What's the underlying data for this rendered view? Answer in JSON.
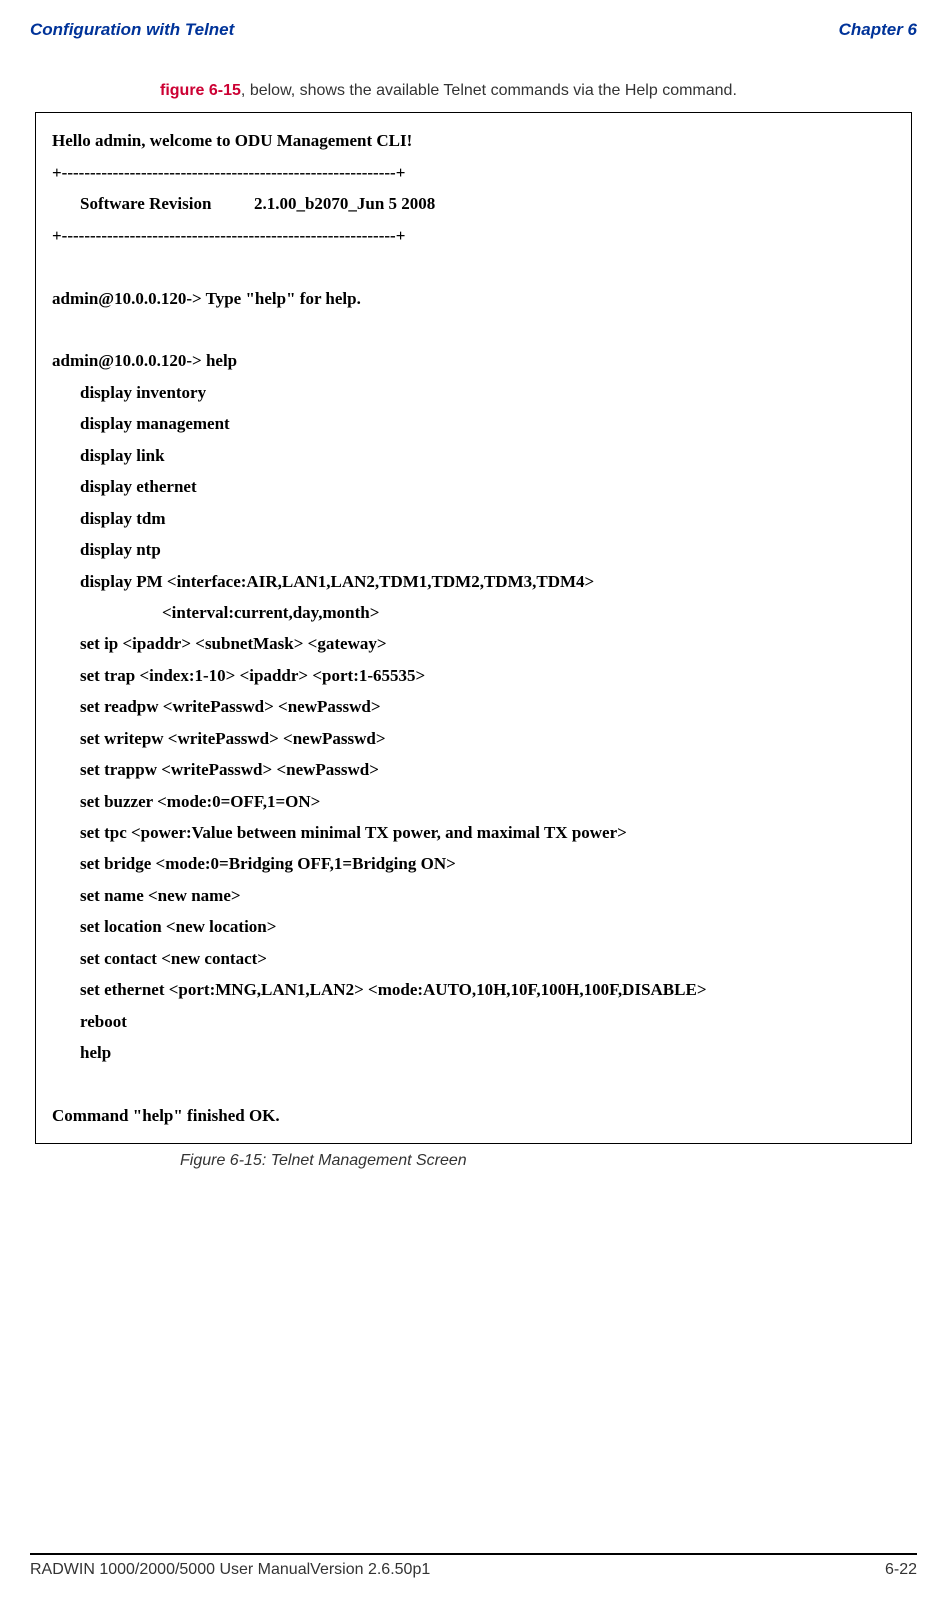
{
  "header": {
    "left": "Configuration with Telnet",
    "right": "Chapter 6"
  },
  "intro": {
    "figref": "figure 6-15",
    "rest": ", below, shows the available Telnet commands via the Help command."
  },
  "telnet": {
    "line1": "Hello admin, welcome to ODU Management CLI!",
    "line2": "+-----------------------------------------------------------+",
    "line3_label": "Software Revision",
    "line3_value": "2.1.00_b2070_Jun  5 2008",
    "line4": "+-----------------------------------------------------------+",
    "line5": "admin@10.0.0.120-> Type \"help\" for help.",
    "line6": "admin@10.0.0.120-> help",
    "cmds": [
      "display inventory",
      "display management",
      "display link",
      "display ethernet",
      "display tdm",
      "display ntp",
      "display PM <interface:AIR,LAN1,LAN2,TDM1,TDM2,TDM3,TDM4>"
    ],
    "interval": "<interval:current,day,month>",
    "cmds2": [
      "set ip <ipaddr> <subnetMask> <gateway>",
      "set trap <index:1-10> <ipaddr> <port:1-65535>",
      "set readpw <writePasswd> <newPasswd>",
      "set writepw <writePasswd> <newPasswd>",
      "set trappw <writePasswd> <newPasswd>",
      "set buzzer <mode:0=OFF,1=ON>",
      "set tpc <power:Value between minimal TX power, and maximal TX power>",
      "set bridge <mode:0=Bridging OFF,1=Bridging ON>",
      "set name <new name>",
      "set location <new location>",
      "set contact <new contact>",
      "set ethernet <port:MNG,LAN1,LAN2> <mode:AUTO,10H,10F,100H,100F,DISABLE>",
      "reboot",
      "help"
    ],
    "line_end": "Command \"help\" finished OK."
  },
  "caption": "Figure 6-15: Telnet Management Screen",
  "footer": {
    "left": "RADWIN 1000/2000/5000 User ManualVersion  2.6.50p1",
    "right": "6-22"
  }
}
